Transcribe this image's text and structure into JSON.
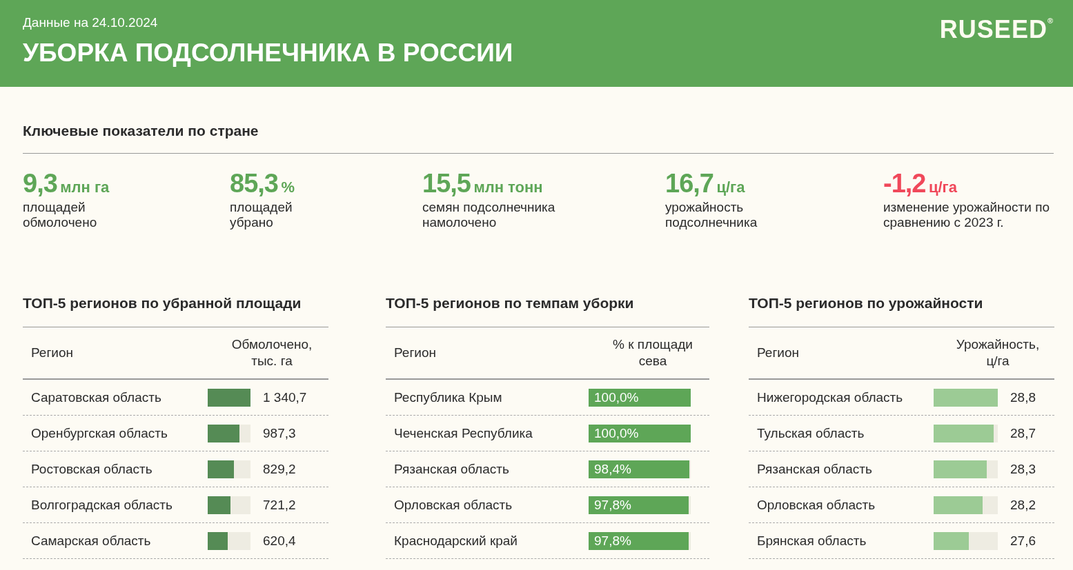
{
  "header": {
    "date": "Данные на 24.10.2024",
    "title": "УБОРКА ПОДСОЛНЕЧНИКА В РОССИИ",
    "logo": "RUSEED",
    "logo_mark": "®"
  },
  "key_section": {
    "title": "Ключевые показатели по стране",
    "kpis": [
      {
        "value": "9,3",
        "unit": "млн га",
        "label": "площадей обмолочено",
        "color": "#5ea657"
      },
      {
        "value": "85,3",
        "unit": "%",
        "label": "площадей убрано",
        "color": "#5ea657"
      },
      {
        "value": "15,5",
        "unit": "млн тонн",
        "label": "семян подсолнечника намолочено",
        "color": "#5ea657"
      },
      {
        "value": "16,7",
        "unit": "ц/га",
        "label": "урожайность подсолнечника",
        "color": "#5ea657"
      },
      {
        "value": "-1,2",
        "unit": "ц/га",
        "label": "изменение урожайности по сравнению с 2023 г.",
        "color": "#f0485a"
      }
    ]
  },
  "tables": [
    {
      "title": "ТОП-5 регионов по убранной площади",
      "kind": "outside",
      "color": "#558b55",
      "columns": [
        "Регион",
        "Обмолочено, тыс. га"
      ],
      "rows": [
        {
          "region": "Саратовская область",
          "value": "1 340,7",
          "level": 1.0
        },
        {
          "region": "Оренбургская область",
          "value": "987,3",
          "level": 0.74
        },
        {
          "region": "Ростовская область",
          "value": "829,2",
          "level": 0.62
        },
        {
          "region": "Волгоградская область",
          "value": "721,2",
          "level": 0.54
        },
        {
          "region": "Самарская область",
          "value": "620,4",
          "level": 0.46
        }
      ]
    },
    {
      "title": "ТОП-5 регионов по темпам уборки",
      "kind": "inside",
      "color": "#5ea657",
      "columns": [
        "Регион",
        "% к площади сева"
      ],
      "rows": [
        {
          "region": "Республика Крым",
          "value": "100,0%",
          "level": 1.0
        },
        {
          "region": "Чеченская Республика",
          "value": "100,0%",
          "level": 1.0
        },
        {
          "region": "Рязанская область",
          "value": "98,4%",
          "level": 0.984
        },
        {
          "region": "Орловская область",
          "value": "97,8%",
          "level": 0.978
        },
        {
          "region": "Краснодарский край",
          "value": "97,8%",
          "level": 0.978
        }
      ]
    },
    {
      "title": "ТОП-5 регионов по урожайности",
      "kind": "outside",
      "color": "#9ccb95",
      "columns": [
        "Регион",
        "Урожайность, ц/га"
      ],
      "rows": [
        {
          "region": "Нижегородская область",
          "value": "28,8",
          "level": 1.0
        },
        {
          "region": "Тульская область",
          "value": "28,7",
          "level": 0.94
        },
        {
          "region": "Рязанская область",
          "value": "28,3",
          "level": 0.83
        },
        {
          "region": "Орловская область",
          "value": "28,2",
          "level": 0.76
        },
        {
          "region": "Брянская область",
          "value": "27,6",
          "level": 0.55
        }
      ]
    }
  ]
}
